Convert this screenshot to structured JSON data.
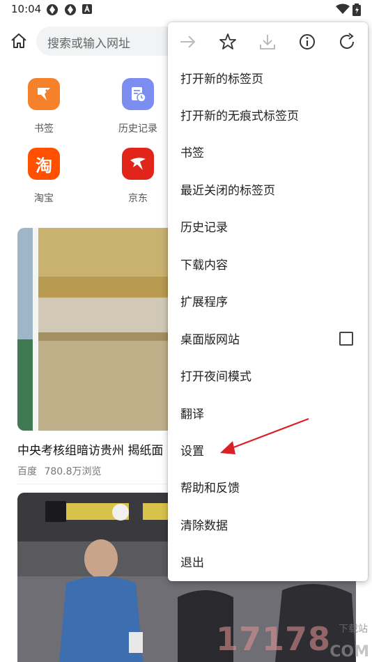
{
  "status_bar": {
    "time": "10:04",
    "left_icons": [
      "sync-icon",
      "sync-icon",
      "notification-a-icon"
    ],
    "right_icons": [
      "wifi-icon",
      "battery-icon"
    ]
  },
  "toolbar": {
    "home_icon": "home-icon",
    "search_placeholder": "搜索或输入网址"
  },
  "shortcuts": [
    {
      "label": "书签",
      "icon": "bookmark-tile-icon",
      "color": "#f5822a"
    },
    {
      "label": "历史记录",
      "icon": "history-tile-icon",
      "color": "#7c8df0"
    },
    {
      "label": "淘宝",
      "icon": "taobao-icon",
      "color": "#ff5000",
      "glyph": "淘"
    },
    {
      "label": "京东",
      "icon": "jd-icon",
      "color": "#e1251b"
    }
  ],
  "feed": [
    {
      "title": "中央考核组暗访贵州 揭纸面",
      "source": "百度",
      "views": "780.8万浏览"
    }
  ],
  "menu": {
    "tools": [
      {
        "name": "forward-icon"
      },
      {
        "name": "star-icon"
      },
      {
        "name": "download-icon"
      },
      {
        "name": "info-icon"
      },
      {
        "name": "refresh-icon"
      }
    ],
    "items": [
      {
        "label": "打开新的标签页"
      },
      {
        "label": "打开新的无痕式标签页"
      },
      {
        "label": "书签"
      },
      {
        "label": "最近关闭的标签页"
      },
      {
        "label": "历史记录"
      },
      {
        "label": "下载内容"
      },
      {
        "label": "扩展程序"
      },
      {
        "label": "桌面版网站",
        "checkbox": false
      },
      {
        "label": "打开夜间模式"
      },
      {
        "label": "翻译"
      },
      {
        "label": "设置"
      },
      {
        "label": "帮助和反馈"
      },
      {
        "label": "清除数据"
      },
      {
        "label": "退出"
      }
    ]
  },
  "annotation": {
    "color": "#d92027",
    "target": "设置"
  },
  "watermark": {
    "number": "17178",
    "site": "下载站",
    "domain": "COM"
  }
}
